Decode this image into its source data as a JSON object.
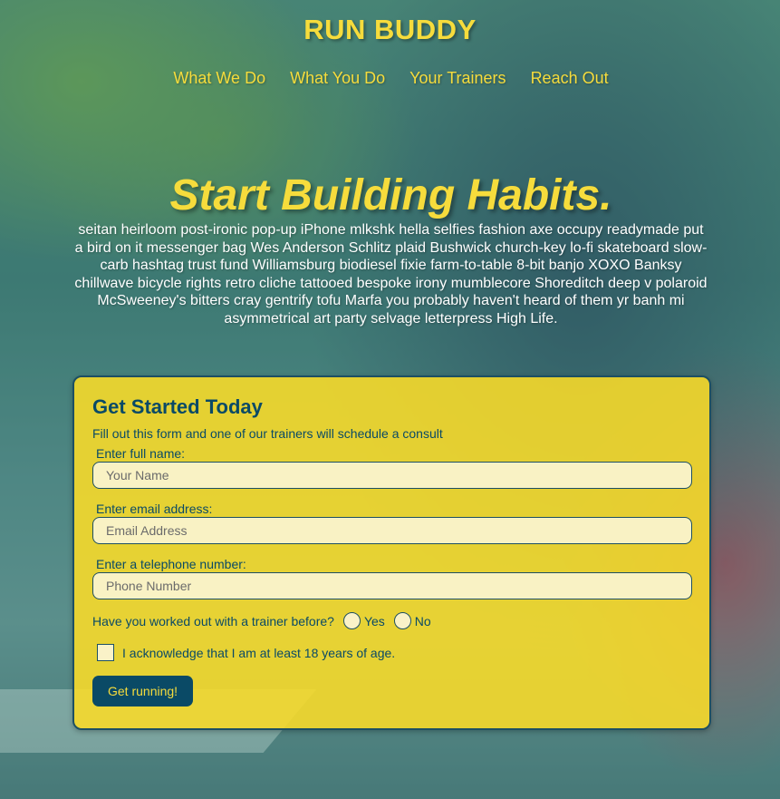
{
  "header": {
    "brand": "RUN BUDDY",
    "nav": [
      {
        "label": "What We Do"
      },
      {
        "label": "What You Do"
      },
      {
        "label": "Your Trainers"
      },
      {
        "label": "Reach Out"
      }
    ]
  },
  "hero": {
    "title": "Start Building Habits.",
    "body": "seitan heirloom post-ironic pop-up iPhone mlkshk hella selfies fashion axe occupy readymade put a bird on it messenger bag Wes Anderson Schlitz plaid Bushwick church-key lo-fi skateboard slow-carb hashtag trust fund Williamsburg biodiesel fixie farm-to-table 8-bit banjo XOXO Banksy chillwave bicycle rights retro cliche tattooed bespoke irony mumblecore Shoreditch deep v polaroid McSweeney's bitters cray gentrify tofu Marfa you probably haven't heard of them yr banh mi asymmetrical art party selvage letterpress High Life."
  },
  "form": {
    "title": "Get Started Today",
    "subtitle": "Fill out this form and one of our trainers will schedule a consult",
    "fields": [
      {
        "label": "Enter full name:",
        "placeholder": "Your Name",
        "value": ""
      },
      {
        "label": "Enter email address:",
        "placeholder": "Email Address",
        "value": ""
      },
      {
        "label": "Enter a telephone number:",
        "placeholder": "Phone Number",
        "value": ""
      }
    ],
    "trainer_question": "Have you worked out with a trainer before?",
    "radio_yes": "Yes",
    "radio_no": "No",
    "acknowledge": "I acknowledge that I am at least 18 years of age.",
    "submit": "Get running!"
  },
  "colors": {
    "accent": "#f6dc3c",
    "primary": "#0a4a66",
    "form_bg": "#fadc28"
  }
}
